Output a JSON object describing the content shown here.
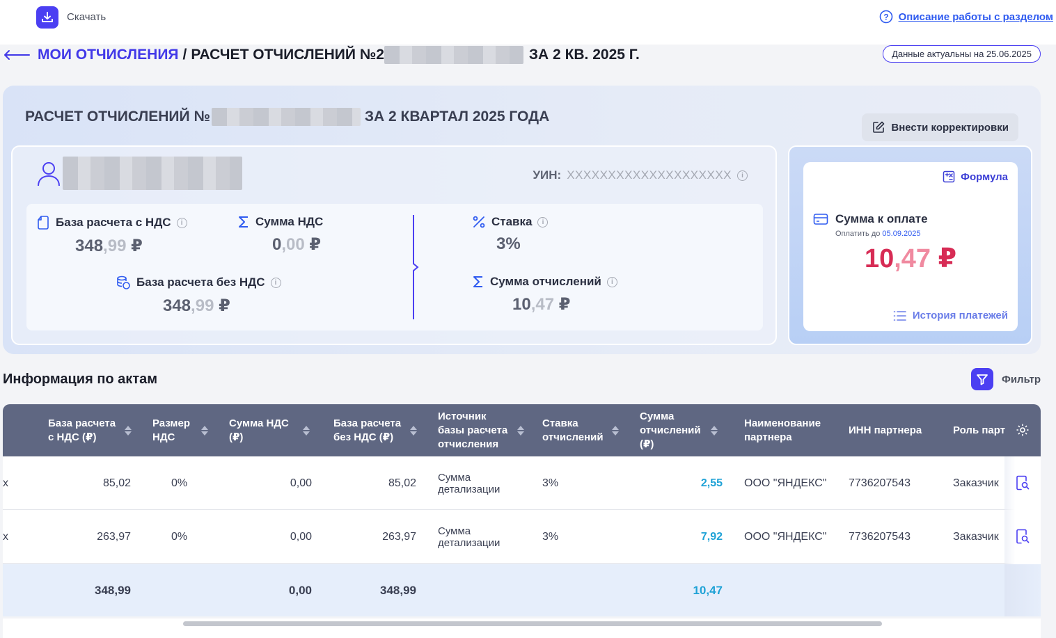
{
  "topbar": {
    "download_label": "Скачать",
    "help_link": "Описание работы с разделом"
  },
  "breadcrumb": {
    "parent": "МОИ ОТЧИСЛЕНИЯ",
    "separator": "/",
    "current_prefix": "РАСЧЕТ ОТЧИСЛЕНИЙ №2",
    "current_suffix": "ЗА 2 КВ. 2025 Г."
  },
  "actual_badge": "Данные актуальны на 25.06.2025",
  "panel": {
    "title_prefix": "РАСЧЕТ ОТЧИСЛЕНИЙ №",
    "title_suffix": "ЗА 2 КВАРТАЛ 2025 ГОДА",
    "corrections_button": "Внести корректировки",
    "uin_label": "УИН:",
    "uin_value": "XXXXXXXXXXXXXXXXXXXX",
    "metrics": {
      "base_vat": {
        "label": "База расчета с НДС",
        "int": "348",
        "frac": ",99",
        "cur": " ₽"
      },
      "vat_sum": {
        "label": "Сумма НДС",
        "int": "0",
        "frac": ",00",
        "cur": " ₽"
      },
      "base_no_vat": {
        "label": "База расчета без НДС",
        "int": "348",
        "frac": ",99",
        "cur": " ₽"
      },
      "rate": {
        "label": "Ставка",
        "value": "3%"
      },
      "deduction_sum": {
        "label": "Сумма отчислений",
        "int": "10",
        "frac": ",47",
        "cur": " ₽"
      }
    },
    "payment": {
      "formula_link": "Формула",
      "label": "Сумма к оплате",
      "due_prefix": "Оплатить до ",
      "due_date": "05.09.2025",
      "amount_int": "10",
      "amount_frac": ",47",
      "amount_cur": " ₽",
      "history_link": "История платежей"
    }
  },
  "acts": {
    "title": "Информация по актам",
    "filter_label": "Фильтр",
    "columns": [
      "База расчета с НДС (₽)",
      "Размер НДС",
      "Сумма НДС (₽)",
      "База расчета без НДС (₽)",
      "Источник базы расчета отчисления",
      "Ставка отчислений",
      "Сумма отчислений (₽)",
      "Наименование партнера",
      "ИНН партнера",
      "Роль партн"
    ],
    "rows": [
      {
        "lead": "х",
        "base_vat": "85,02",
        "vat_rate": "0%",
        "vat_sum": "0,00",
        "base_no_vat": "85,02",
        "source": "Сумма детализации",
        "rate": "3%",
        "deduction": "2,55",
        "partner": "ООО \"ЯНДЕКС\"",
        "inn": "7736207543",
        "role": "Заказчик"
      },
      {
        "lead": "х",
        "base_vat": "263,97",
        "vat_rate": "0%",
        "vat_sum": "0,00",
        "base_no_vat": "263,97",
        "source": "Сумма детализации",
        "rate": "3%",
        "deduction": "7,92",
        "partner": "ООО \"ЯНДЕКС\"",
        "inn": "7736207543",
        "role": "Заказчик"
      }
    ],
    "totals": {
      "base_vat": "348,99",
      "vat_sum": "0,00",
      "base_no_vat": "348,99",
      "deduction": "10,47"
    }
  },
  "colors": {
    "accent": "#4b3ff2",
    "link": "#2f5bf0",
    "amount": "#d72c55",
    "deduction": "#1fa2d6",
    "header": "#5f6782"
  },
  "icons": [
    "download-icon",
    "help-icon",
    "back-arrow-icon",
    "edit-icon",
    "user-icon",
    "info-icon",
    "wallet-icon",
    "sum-icon",
    "percent-icon",
    "coins-icon",
    "formula-icon",
    "card-icon",
    "list-icon",
    "filter-icon",
    "sort-icon",
    "gear-icon",
    "search-doc-icon"
  ]
}
